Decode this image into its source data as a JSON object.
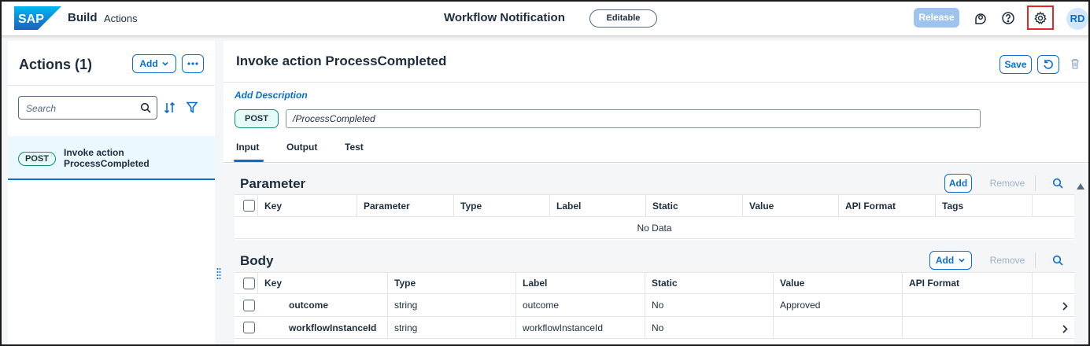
{
  "shell": {
    "brand_title": "Build",
    "brand_subtitle": "Actions",
    "center_title": "Workflow Notification",
    "status_badge": "Editable",
    "release_label": "Release",
    "avatar_initials": "RD",
    "logo_text": "SAP"
  },
  "left_panel": {
    "title": "Actions (1)",
    "add_label": "Add",
    "search_placeholder": "Search",
    "items": [
      {
        "method": "POST",
        "line1": "Invoke action",
        "line2": "ProcessCompleted"
      }
    ]
  },
  "detail": {
    "title": "Invoke action ProcessCompleted",
    "save_label": "Save",
    "add_description": "Add Description",
    "method": "POST",
    "path": "/ProcessCompleted",
    "tabs": [
      "Input",
      "Output",
      "Test"
    ],
    "active_tab": "Input"
  },
  "parameter": {
    "title": "Parameter",
    "add_label": "Add",
    "remove_label": "Remove",
    "columns": [
      "Key",
      "Parameter",
      "Type",
      "Label",
      "Static",
      "Value",
      "API Format",
      "Tags"
    ],
    "no_data": "No Data"
  },
  "body": {
    "title": "Body",
    "add_label": "Add",
    "remove_label": "Remove",
    "columns": [
      "Key",
      "Type",
      "Label",
      "Static",
      "Value",
      "API Format"
    ],
    "rows": [
      {
        "key": "outcome",
        "type": "string",
        "label": "outcome",
        "static": "No",
        "value": "Approved",
        "api_format": ""
      },
      {
        "key": "workflowInstanceId",
        "type": "string",
        "label": "workflowInstanceId",
        "static": "No",
        "value": "",
        "api_format": ""
      }
    ]
  },
  "colors": {
    "accent": "#0a6ed1",
    "highlight_box": "#e0282b",
    "post_pill": "#158a7f",
    "release_disabled": "#9ec3ee"
  },
  "icons": [
    "sap-logo",
    "joule-icon",
    "help-icon",
    "gear-icon",
    "chevron-down-icon",
    "more-icon",
    "search-icon",
    "sort-icon",
    "filter-icon",
    "revert-icon",
    "delete-icon",
    "chevron-right-icon",
    "splitter-grip-icon",
    "scroll-up-icon"
  ]
}
